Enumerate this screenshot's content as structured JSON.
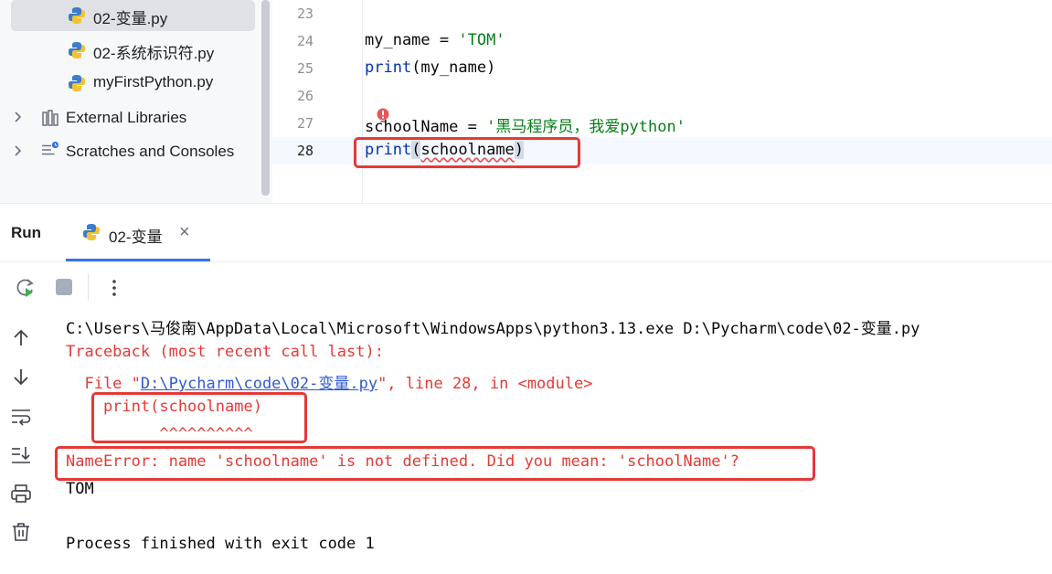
{
  "project_tree": {
    "items": [
      {
        "label": "02-变量.py"
      },
      {
        "label": "02-系统标识符.py"
      },
      {
        "label": "myFirstPython.py"
      },
      {
        "label": "External Libraries"
      },
      {
        "label": "Scratches and Consoles"
      }
    ]
  },
  "editor": {
    "line_numbers": [
      "23",
      "24",
      "25",
      "26",
      "27",
      "28"
    ],
    "lines": {
      "l24_var": "my_name",
      "l24_eq": " = ",
      "l24_str": "'TOM'",
      "l25_fn": "print",
      "l25_args": "(my_name)",
      "l27_var": "schoolName",
      "l27_eq": " = ",
      "l27_str": "'黑马程序员，我爱python'",
      "l28_fn": "print",
      "l28_open": "(",
      "l28_arg": "schoolname",
      "l28_close": ")"
    }
  },
  "run_panel": {
    "title": "Run",
    "tab_label": "02-变量",
    "tab_close": "×"
  },
  "console": {
    "cmd": "C:\\Users\\马俊南\\AppData\\Local\\Microsoft\\WindowsApps\\python3.13.exe D:\\Pycharm\\code\\02-变量.py",
    "traceback": "Traceback (most recent call last):",
    "file_prefix": "  File \"",
    "file_link": "D:\\Pycharm\\code\\02-变量.py",
    "file_suffix": "\", line 28, in <module>",
    "code_line": "    print(schoolname)",
    "caret_line": "          ^^^^^^^^^^",
    "error": "NameError: name 'schoolname' is not defined. Did you mean: 'schoolName'?",
    "output": "TOM",
    "finished": "Process finished with exit code 1"
  },
  "colors": {
    "accent": "#3574f0",
    "error": "#e53935",
    "string": "#067d17",
    "keyword": "#0033b3"
  }
}
